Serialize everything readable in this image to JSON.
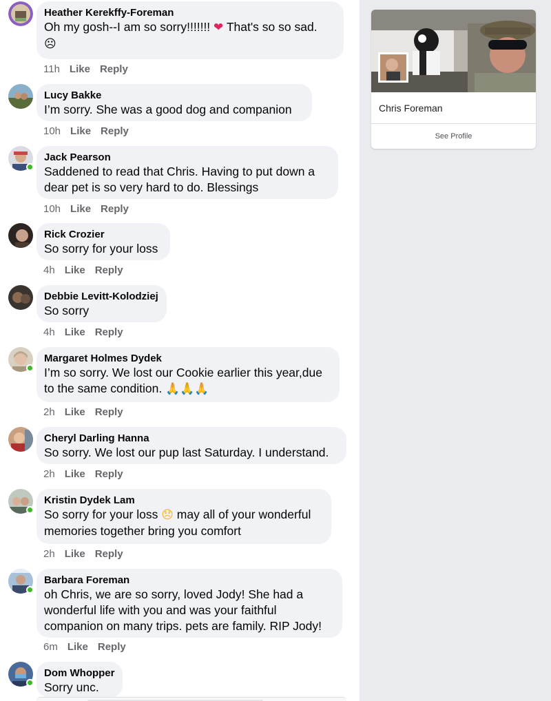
{
  "comments": [
    {
      "author": "Heather Kerekffy-Foreman",
      "line1": "Oh my gosh--I am so sorry!!!!!!! ",
      "heart": "❤",
      "line1b": " That's so so sad.",
      "emoji": "☹",
      "time": "11h",
      "like": "Like",
      "reply": "Reply"
    },
    {
      "author": "Lucy Bakke",
      "text": "I’m sorry.  She was a good dog and companion",
      "time": "10h",
      "like": "Like",
      "reply": "Reply"
    },
    {
      "author": "Jack Pearson",
      "line1": "Saddened to read that Chris.  Having to put down a",
      "line2": "dear  pet is so very hard to do. Blessings",
      "time": "10h",
      "like": "Like",
      "reply": "Reply"
    },
    {
      "author": "Rick Crozier",
      "text": "So sorry for your loss",
      "time": "4h",
      "like": "Like",
      "reply": "Reply"
    },
    {
      "author": "Debbie Levitt-Kolodziej",
      "text": "So sorry",
      "time": "4h",
      "like": "Like",
      "reply": "Reply"
    },
    {
      "author": "Margaret Holmes Dydek",
      "line1": "I’m so sorry. We lost our Cookie earlier this year,due",
      "line2": "to the same condition. ",
      "emoji": "🙏🙏🙏",
      "time": "2h",
      "like": "Like",
      "reply": "Reply"
    },
    {
      "author": "Cheryl Darling Hanna",
      "text": "So sorry. We lost our pup last Saturday. I understand.",
      "time": "2h",
      "like": "Like",
      "reply": "Reply"
    },
    {
      "author": "Kristin Dydek Lam",
      "line1a": "So sorry for your loss ",
      "emoji": "😞",
      "line1b": " may all of your wonderful",
      "line2": "memories together bring you comfort",
      "time": "2h",
      "like": "Like",
      "reply": "Reply"
    },
    {
      "author": "Barbara Foreman",
      "line1": "oh Chris, we are so sorry, loved Jody!  She had a",
      "line2": "wonderful life with you and was your faithful",
      "line3": "companion on many trips.  pets are family. RIP Jody!",
      "time": "6m",
      "like": "Like",
      "reply": "Reply"
    },
    {
      "author": "Dom Whopper",
      "text": "Sorry unc."
    }
  ],
  "profile": {
    "name": "Chris Foreman",
    "see_profile": "See Profile"
  },
  "colors": {
    "bubble": "#f0f2f5",
    "meta": "#65676b",
    "online": "#42b72a",
    "sidebar": "#e9ebee"
  }
}
